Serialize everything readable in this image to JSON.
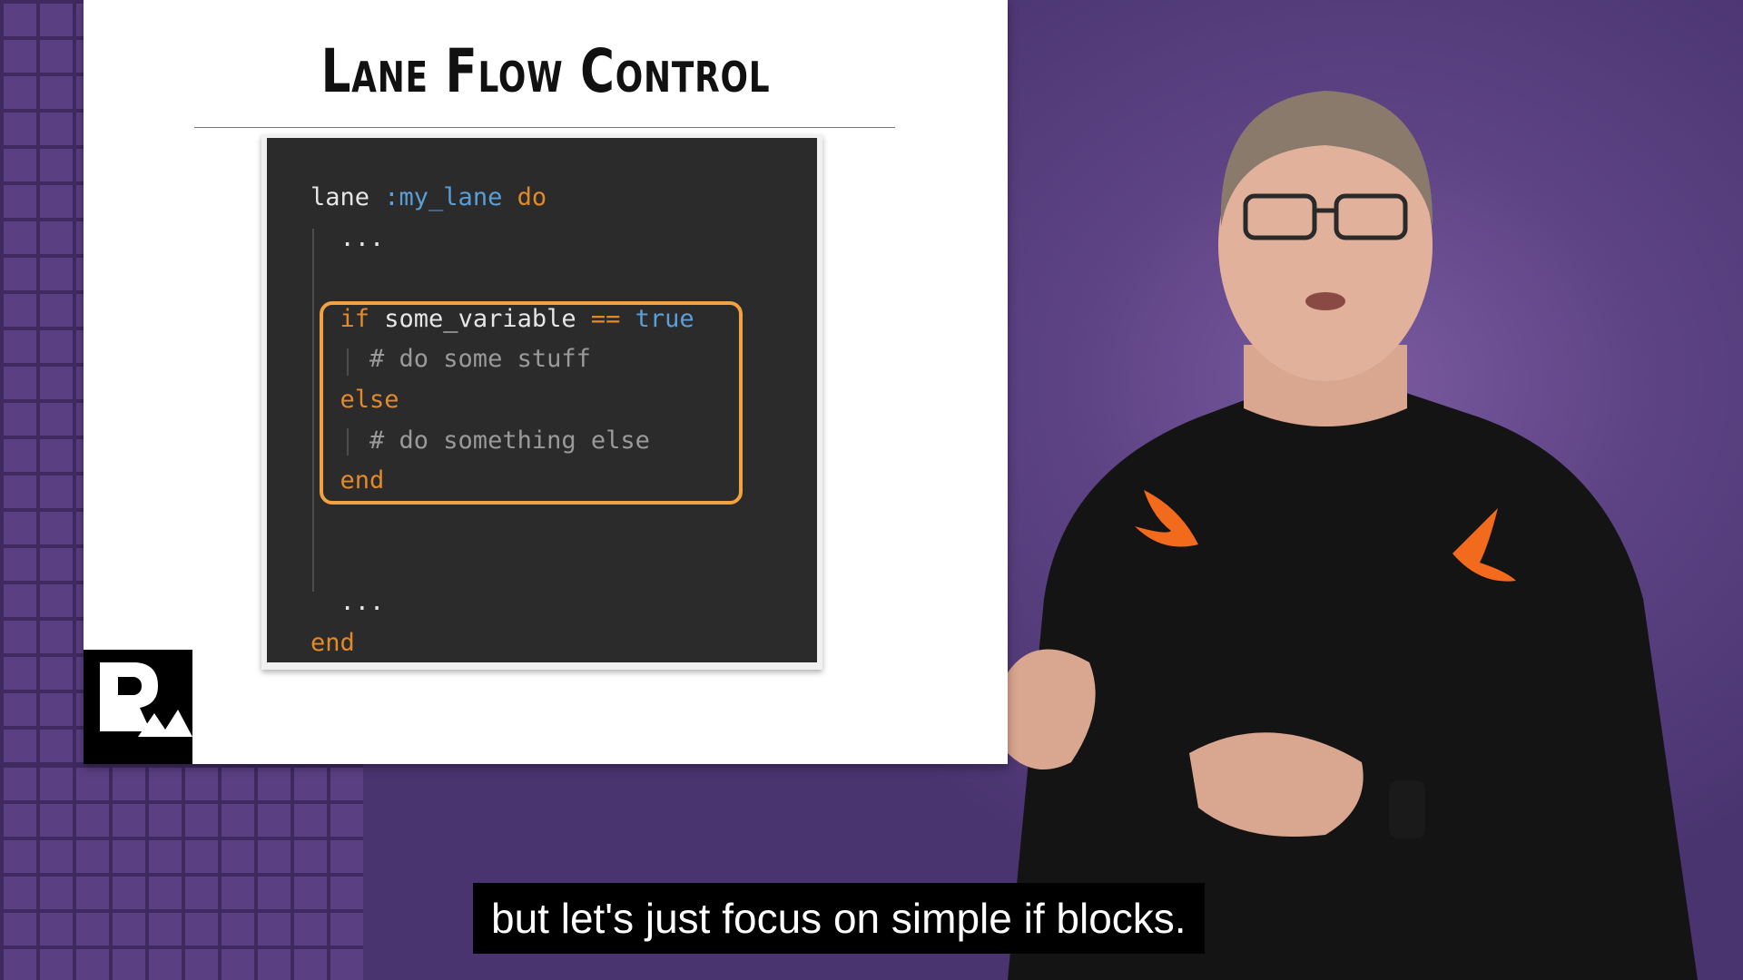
{
  "slide": {
    "title": "Lane Flow Control",
    "code_lines": [
      {
        "parts": [
          {
            "t": "lane ",
            "c": "plain"
          },
          {
            "t": ":my_lane",
            "c": "sym"
          },
          {
            "t": " do",
            "c": "kw"
          }
        ]
      },
      {
        "parts": [
          {
            "t": "  ...",
            "c": "plain"
          }
        ]
      },
      {
        "parts": []
      },
      {
        "parts": [
          {
            "t": "  if",
            "c": "kw"
          },
          {
            "t": " some_variable ",
            "c": "plain"
          },
          {
            "t": "==",
            "c": "kw"
          },
          {
            "t": " true",
            "c": "bool"
          }
        ]
      },
      {
        "parts": [
          {
            "t": "    # do some stuff",
            "c": "cmt"
          }
        ]
      },
      {
        "parts": [
          {
            "t": "  else",
            "c": "kw"
          }
        ]
      },
      {
        "parts": [
          {
            "t": "    # do something else",
            "c": "cmt"
          }
        ]
      },
      {
        "parts": [
          {
            "t": "  end",
            "c": "kw"
          }
        ]
      },
      {
        "parts": []
      },
      {
        "parts": []
      },
      {
        "parts": [
          {
            "t": "  ...",
            "c": "plain"
          }
        ]
      },
      {
        "parts": [
          {
            "t": "end",
            "c": "kw"
          }
        ]
      }
    ]
  },
  "colors": {
    "keyword": "#e28a2a",
    "symbol": "#5a9fd8",
    "comment": "#9a9a9a",
    "highlight": "#f2a241",
    "code_background": "#2b2b2b"
  },
  "logo": {
    "icon": "rw-logo-icon"
  },
  "subtitle": {
    "text": "but let's just focus on simple if blocks."
  }
}
